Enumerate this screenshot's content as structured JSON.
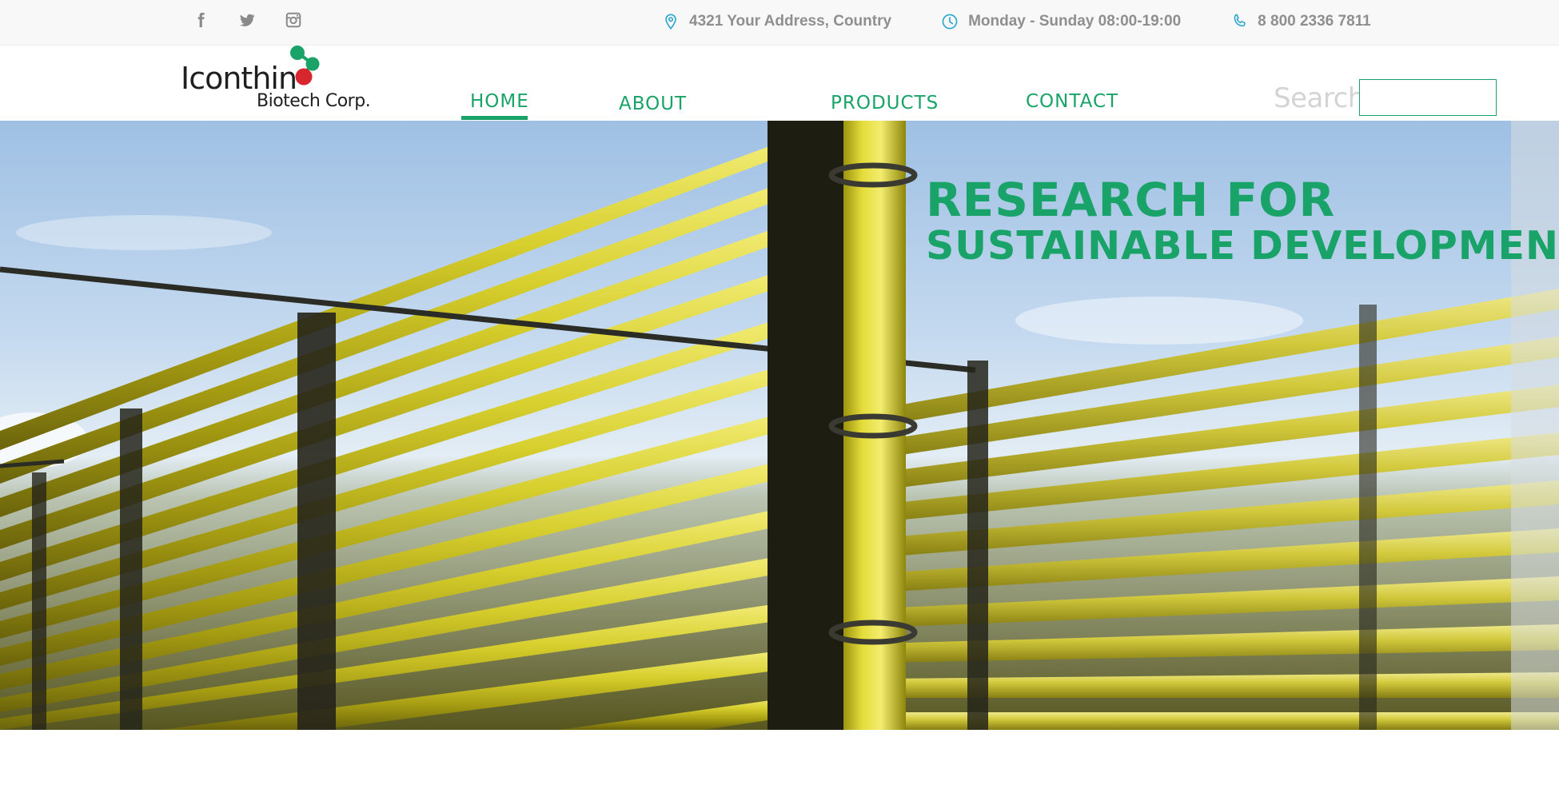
{
  "topbar": {
    "social": [
      {
        "icon": "facebook-icon"
      },
      {
        "icon": "twitter-icon"
      },
      {
        "icon": "instagram-icon"
      }
    ],
    "address": "4321 Your Address, Country",
    "hours": "Monday - Sunday 08:00-19:00",
    "phone": "8 800 2336 7811",
    "icon_color": "#2aa7c9"
  },
  "logo": {
    "word": "Iconthin",
    "subtitle": "Biotech Corp.",
    "mark_colors": [
      "#1aa368",
      "#d7262e"
    ]
  },
  "nav": {
    "home": "HOME",
    "about": "ABOUT",
    "products": "PRODUCTS",
    "contact": "CONTACT",
    "active": "HOME"
  },
  "search": {
    "label": "Search",
    "value": ""
  },
  "hero": {
    "line1": "RESEARCH FOR",
    "line2": "SUSTAINABLE DEVELOPMENT"
  },
  "colors": {
    "accent": "#1aa368",
    "muted_text": "#8f8f8f",
    "topbar_bg": "#f8f8f8"
  }
}
